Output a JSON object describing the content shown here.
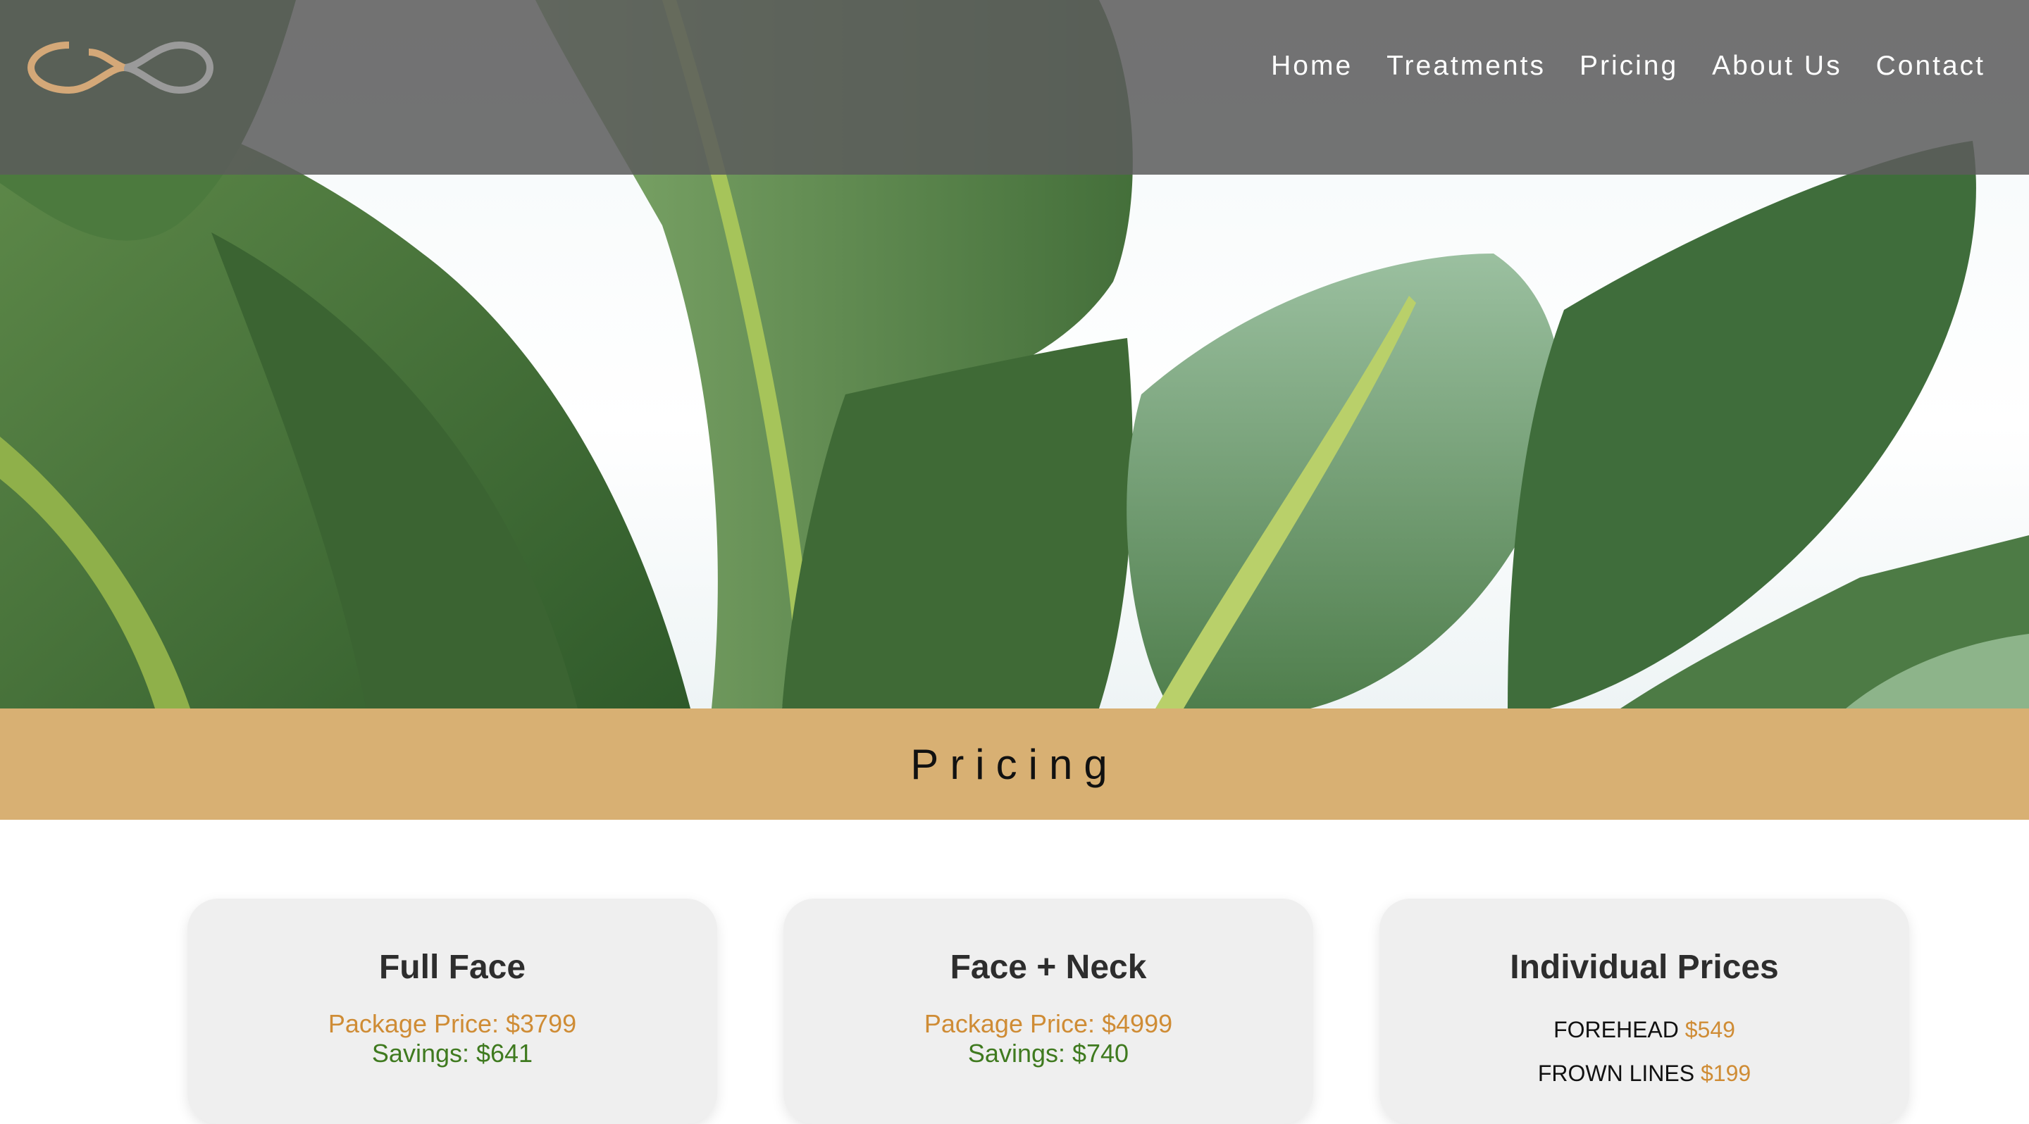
{
  "header": {
    "logo_icon": "infinity-loop-logo",
    "nav": [
      "Home",
      "Treatments",
      "Pricing",
      "About Us",
      "Contact"
    ]
  },
  "hero": {
    "image": "banana-leaves-photo"
  },
  "band": {
    "title": "Pricing"
  },
  "cards": [
    {
      "title": "Full Face",
      "package": "Package Price: $3799",
      "savings": "Savings: $641"
    },
    {
      "title": "Face + Neck",
      "package": "Package Price: $4999",
      "savings": "Savings: $740"
    },
    {
      "title": "Individual Prices",
      "rows": [
        {
          "label": "FOREHEAD",
          "price": "$549"
        },
        {
          "label": "FROWN LINES",
          "price": "$199"
        }
      ]
    }
  ],
  "colors": {
    "band": "#d8b073",
    "accent": "#cf8c35",
    "savings": "#3f7a1f",
    "header": "#5c5c5c"
  }
}
